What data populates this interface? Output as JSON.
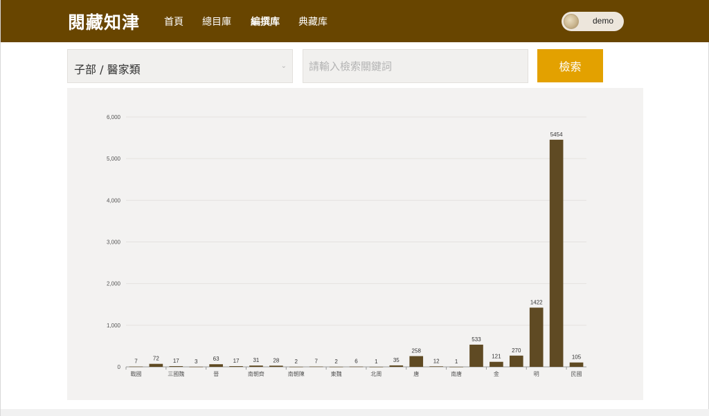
{
  "header": {
    "logo": "閱藏知津",
    "nav": [
      {
        "label": "首頁",
        "active": false
      },
      {
        "label": "總目庫",
        "active": false
      },
      {
        "label": "編撰库",
        "active": true
      },
      {
        "label": "典藏库",
        "active": false
      }
    ],
    "user": {
      "name": "demo"
    },
    "background": "#684500"
  },
  "search": {
    "category_selected": "子部 / 醫家類",
    "placeholder": "請輸入檢索關鍵詞",
    "value": "",
    "button_label": "檢索",
    "button_color": "#e3a100"
  },
  "chart_data": {
    "type": "bar",
    "categories": [
      "戰國",
      "",
      "三國魏",
      "",
      "晉",
      "",
      "南朝齊",
      "",
      "南朝陳",
      "",
      "東魏",
      "",
      "北周",
      "",
      "唐",
      "",
      "南唐",
      "",
      "金",
      "",
      "明",
      "",
      "民國"
    ],
    "values": [
      7,
      72,
      17,
      3,
      63,
      17,
      31,
      28,
      2,
      7,
      2,
      6,
      1,
      35,
      258,
      12,
      1,
      533,
      121,
      270,
      1422,
      5454,
      105
    ],
    "data_labels": [
      "7",
      "72",
      "17",
      "3",
      "63",
      "17",
      "31",
      "28",
      "2",
      "7",
      "2",
      "6",
      "1",
      "35",
      "258",
      "12",
      "1",
      "533",
      "121",
      "270",
      "1422",
      "5454",
      "105"
    ],
    "ylim": [
      0,
      6000
    ],
    "yticks": [
      "0",
      "1,000",
      "2,000",
      "3,000",
      "4,000",
      "5,000",
      "6,000"
    ],
    "grid": true,
    "bar_color": "#5f4a23"
  }
}
